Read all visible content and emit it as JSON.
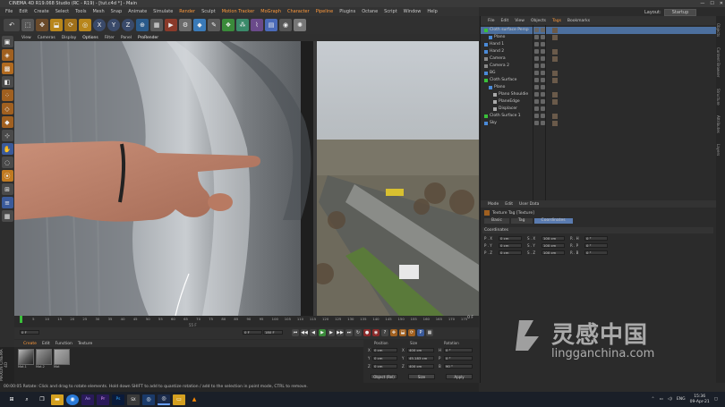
{
  "window": {
    "title": "CINEMA 4D R19.068 Studio (RC - R19) - [tut.c4d *] - Main"
  },
  "menubar": {
    "items": [
      "File",
      "Edit",
      "Create",
      "Select",
      "Tools",
      "Mesh",
      "Snap",
      "Animate",
      "Simulate",
      "Render",
      "Sculpt",
      "Motion Tracker",
      "MoGraph",
      "Character",
      "Pipeline",
      "Plugins",
      "Octane",
      "Script",
      "Window",
      "Help"
    ],
    "highlighted": [
      "Render",
      "Motion Tracker",
      "MoGraph",
      "Character",
      "Pipeline"
    ]
  },
  "layout": {
    "label": "Layout:",
    "value": "Startup"
  },
  "toolbar": {
    "icons": [
      "undo-icon",
      "select-icon",
      "move-icon",
      "scale-icon",
      "rotate-icon",
      "recent-icon",
      "x-axis-icon",
      "y-axis-icon",
      "z-axis-icon",
      "world-icon",
      "render-region-icon",
      "render-view-icon",
      "render-settings-icon",
      "cube-icon",
      "pen-icon",
      "subdivision-icon",
      "array-icon",
      "deformer-icon",
      "scene-icon",
      "camera-icon",
      "light-icon"
    ],
    "axes": [
      "X",
      "Y",
      "Z"
    ]
  },
  "viewport": {
    "menu": [
      "View",
      "Cameras",
      "Display",
      "Options",
      "Filter",
      "Panel",
      "ProRender"
    ]
  },
  "timeline": {
    "ticks": [
      "0",
      "5",
      "10",
      "15",
      "20",
      "25",
      "30",
      "35",
      "40",
      "45",
      "50",
      "55",
      "60",
      "65",
      "70",
      "75",
      "80",
      "85",
      "90",
      "95",
      "100",
      "105",
      "110",
      "115",
      "120",
      "125",
      "130",
      "135",
      "140",
      "145",
      "150",
      "155",
      "160",
      "165",
      "170",
      "175"
    ],
    "current_frame": "0 F",
    "start": "0 F",
    "end": "180 F",
    "playhead_label": "55 F",
    "end_frame_right": "0 F"
  },
  "materials": {
    "menu": [
      "Create",
      "Edit",
      "Function",
      "Texture"
    ],
    "items": [
      {
        "label": "Mat.1"
      },
      {
        "label": "Mat.2"
      },
      {
        "label": "Mat"
      }
    ]
  },
  "coordinates": {
    "headers": [
      "Position",
      "Size",
      "Rotation"
    ],
    "rows": [
      {
        "axis": "X",
        "pos": "0 cm",
        "size": "400 cm",
        "rot_axis": "H",
        "rot": "0 °"
      },
      {
        "axis": "Y",
        "pos": "0 cm",
        "size": "45.183 cm",
        "rot_axis": "P",
        "rot": "0 °"
      },
      {
        "axis": "Z",
        "pos": "0 cm",
        "size": "400 cm",
        "rot_axis": "B",
        "rot": "90 °"
      }
    ],
    "mode_select": "Object (Rel)",
    "size_select": "Size",
    "apply_label": "Apply"
  },
  "status": {
    "text": "00:00:05   Rotate: Click and drag to rotate elements. Hold down SHIFT to add to quantize rotation / add to the selection in point mode, CTRL to remove."
  },
  "object_manager": {
    "menu": [
      "File",
      "Edit",
      "View",
      "Objects",
      "Tags",
      "Bookmarks"
    ],
    "highlighted_menu": "Tags",
    "objects": [
      {
        "name": "Cloth surface Persp",
        "indent": 0,
        "selected": true
      },
      {
        "name": "Plano",
        "indent": 1,
        "selected": false
      },
      {
        "name": "Hand 1",
        "indent": 0,
        "selected": false
      },
      {
        "name": "Hand 2",
        "indent": 0,
        "selected": false
      },
      {
        "name": "Camera",
        "indent": 0,
        "selected": false
      },
      {
        "name": "Camera 2",
        "indent": 0,
        "selected": false
      },
      {
        "name": "BG",
        "indent": 0,
        "selected": false
      },
      {
        "name": "Cloth Surface",
        "indent": 0,
        "selected": false
      },
      {
        "name": "Plano",
        "indent": 1,
        "selected": false
      },
      {
        "name": "Plano Shouldie",
        "indent": 2,
        "selected": false
      },
      {
        "name": "PlaneEdge",
        "indent": 2,
        "selected": false
      },
      {
        "name": "Displacer",
        "indent": 2,
        "selected": false
      },
      {
        "name": "Cloth Surface 1",
        "indent": 0,
        "selected": false
      },
      {
        "name": "Sky",
        "indent": 0,
        "selected": false
      }
    ]
  },
  "attribute_manager": {
    "menu": [
      "Mode",
      "Edit",
      "User Data"
    ],
    "header": "Texture Tag [Texture]",
    "tabs": [
      "Basic",
      "Tag",
      "Coordinates"
    ],
    "active_tab": "Coordinates",
    "section": "Coordinates",
    "rows": [
      {
        "p_axis": "P . X",
        "p_val": "0 cm",
        "s_axis": "S . X",
        "s_val": "100 cm",
        "r_axis": "R . H",
        "r_val": "0 °"
      },
      {
        "p_axis": "P . Y",
        "p_val": "0 cm",
        "s_axis": "S . Y",
        "s_val": "100 cm",
        "r_axis": "R . P",
        "r_val": "0 °"
      },
      {
        "p_axis": "P . Z",
        "p_val": "0 cm",
        "s_axis": "S . Z",
        "s_val": "100 cm",
        "r_axis": "R . B",
        "r_val": "0 °"
      }
    ]
  },
  "right_strip": {
    "tabs": [
      "Objects",
      "Content Browser",
      "Structure",
      "Attributes",
      "Layers"
    ]
  },
  "taskbar": {
    "icons": [
      "windows-icon",
      "search-icon",
      "task-view-icon",
      "file-explorer-icon",
      "chrome-icon",
      "after-effects-icon",
      "premiere-icon",
      "photoshop-icon",
      "ae-plugin-icon",
      "cinema4d-icon",
      "c4d-icon",
      "folder-icon",
      "vlc-icon"
    ],
    "lang": "ENG",
    "time": "15:36",
    "date": "09-Apr-21"
  },
  "watermark": {
    "cn": "灵感中国",
    "url": "lingganchina.com"
  },
  "maxon_label": "MAXON CINEMA 4D",
  "colors": {
    "accent": "#ff9a3c",
    "selected_row": "#4c6f9e",
    "active_tab": "#5a7bb0"
  }
}
